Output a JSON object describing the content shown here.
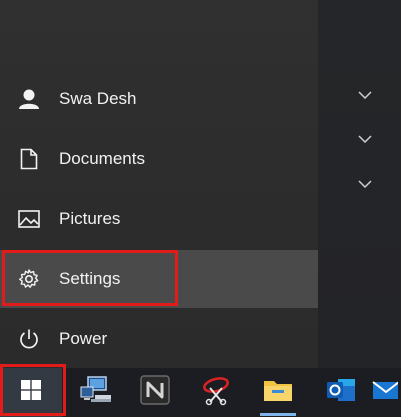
{
  "start_menu": {
    "items": [
      {
        "label": "Swa Desh",
        "icon": "user-icon"
      },
      {
        "label": "Documents",
        "icon": "document-icon"
      },
      {
        "label": "Pictures",
        "icon": "picture-icon"
      },
      {
        "label": "Settings",
        "icon": "gear-icon"
      },
      {
        "label": "Power",
        "icon": "power-icon"
      }
    ],
    "selected_item": "Settings"
  },
  "taskbar": {
    "items": [
      {
        "name": "start-button",
        "icon": "windows-logo-icon"
      },
      {
        "name": "remote-desktop-app",
        "icon": "computer-network-icon"
      },
      {
        "name": "n-app",
        "icon": "n-logo-icon"
      },
      {
        "name": "snipping-tool-app",
        "icon": "scissors-icon"
      },
      {
        "name": "file-explorer-app",
        "icon": "folder-icon"
      },
      {
        "name": "outlook-app",
        "icon": "outlook-icon"
      },
      {
        "name": "mail-app",
        "icon": "mail-icon"
      }
    ]
  },
  "colors": {
    "highlight_border": "#e21b1b",
    "menu_background": "#2d2d2d",
    "taskbar_background": "#1b1d22",
    "selected_background": "#4a4a4a"
  }
}
